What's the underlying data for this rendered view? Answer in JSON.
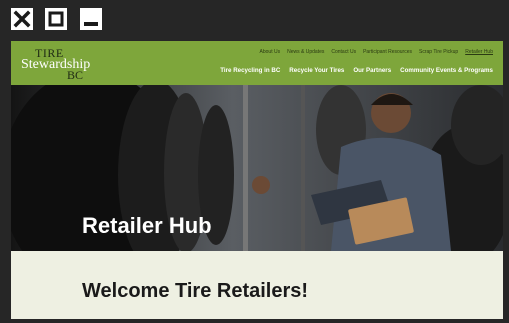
{
  "window": {
    "close_icon": "close-icon",
    "maximize_icon": "maximize-icon",
    "minimize_icon": "minimize-icon"
  },
  "logo": {
    "line1": "TIRE",
    "line2": "Stewardship",
    "line3": "BC"
  },
  "utility_nav": [
    "About Us",
    "News & Updates",
    "Contact Us",
    "Participant Resources",
    "Scrap Tire Pickup",
    "Retailer Hub"
  ],
  "main_nav": [
    "Tire Recycling in BC",
    "Recycle Your Tires",
    "Our Partners",
    "Community Events & Programs"
  ],
  "hero": {
    "title": "Retailer Hub"
  },
  "welcome": {
    "heading": "Welcome Tire Retailers!"
  },
  "colors": {
    "header_green": "#7ea63b",
    "welcome_bg": "#eef0e2",
    "chrome_dark": "#262626"
  }
}
